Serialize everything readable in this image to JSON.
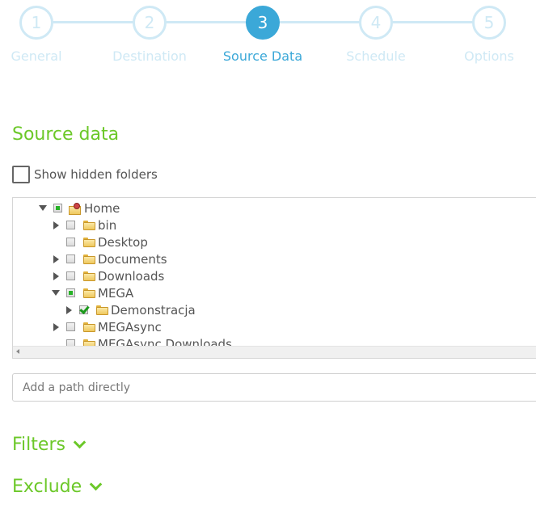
{
  "wizard": {
    "steps": [
      {
        "number": "1",
        "label": "General",
        "active": false
      },
      {
        "number": "2",
        "label": "Destination",
        "active": false
      },
      {
        "number": "3",
        "label": "Source Data",
        "active": true
      },
      {
        "number": "4",
        "label": "Schedule",
        "active": false
      },
      {
        "number": "5",
        "label": "Options",
        "active": false
      }
    ]
  },
  "source": {
    "title": "Source data",
    "show_hidden_label": "Show hidden folders",
    "show_hidden_checked": false
  },
  "tree": {
    "nodes": [
      {
        "label": "Home",
        "level": 0,
        "expander": "expanded",
        "state": "partial",
        "icon": "home-folder-icon"
      },
      {
        "label": "bin",
        "level": 1,
        "expander": "collapsed",
        "state": "unchecked",
        "icon": "folder-icon"
      },
      {
        "label": "Desktop",
        "level": 1,
        "expander": "none",
        "state": "unchecked",
        "icon": "folder-icon"
      },
      {
        "label": "Documents",
        "level": 1,
        "expander": "collapsed",
        "state": "unchecked",
        "icon": "folder-icon"
      },
      {
        "label": "Downloads",
        "level": 1,
        "expander": "collapsed",
        "state": "unchecked",
        "icon": "folder-icon"
      },
      {
        "label": "MEGA",
        "level": 1,
        "expander": "expanded",
        "state": "partial",
        "icon": "folder-icon"
      },
      {
        "label": "Demonstracja",
        "level": 2,
        "expander": "collapsed",
        "state": "checked",
        "icon": "folder-icon"
      },
      {
        "label": "MEGAsync",
        "level": 1,
        "expander": "collapsed",
        "state": "unchecked",
        "icon": "folder-icon"
      },
      {
        "label": "MEGAsync Downloads",
        "level": 1,
        "expander": "none",
        "state": "unchecked",
        "icon": "folder-icon"
      }
    ]
  },
  "path_input": {
    "placeholder": "Add a path directly",
    "value": ""
  },
  "sections": {
    "filters_label": "Filters",
    "exclude_label": "Exclude"
  },
  "colors": {
    "accent_blue": "#3ba8d8",
    "inactive_step": "#cfe9f5",
    "green": "#6cc829"
  }
}
